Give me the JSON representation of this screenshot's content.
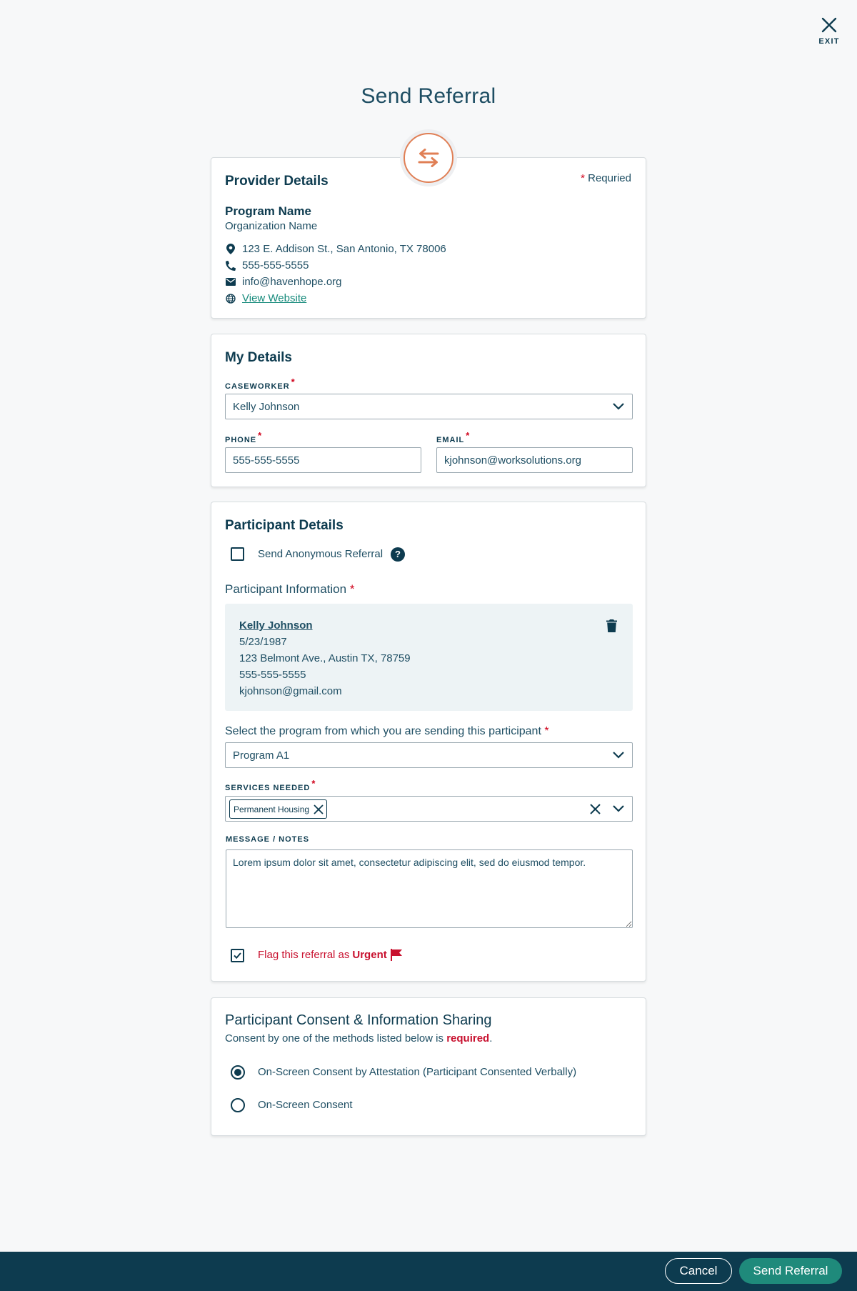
{
  "exit": {
    "label": "EXIT",
    "icon": "close-icon"
  },
  "page_title": "Send Referral",
  "hero_icon": "swap-arrows-icon",
  "colors": {
    "primary": "#0d3b4f",
    "accent": "#1f8a7b",
    "orange": "#e07f55",
    "required": "#d0021b",
    "urgent": "#c8102e"
  },
  "provider": {
    "title": "Provider Details",
    "required_note": "Requried",
    "program_name": "Program Name",
    "org_name": "Organization Name",
    "address": "123 E. Addison St., San Antonio, TX 78006",
    "phone": "555-555-5555",
    "email": "info@havenhope.org",
    "website_link": "View Website"
  },
  "my_details": {
    "title": "My Details",
    "caseworker_label": "CASEWORKER",
    "caseworker_value": "Kelly Johnson",
    "phone_label": "PHONE",
    "phone_value": "555-555-5555",
    "email_label": "EMAIL",
    "email_value": "kjohnson@worksolutions.org"
  },
  "participant": {
    "title": "Participant Details",
    "anonymous_label": "Send Anonymous Referral",
    "anonymous_checked": false,
    "help": "?",
    "info_label": "Participant Information",
    "name": "Kelly Johnson",
    "dob": "5/23/1987",
    "address": "123 Belmont Ave., Austin TX, 78759",
    "phone": "555-555-5555",
    "email": "kjohnson@gmail.com",
    "program_label": "Select the program from which you are sending this participant",
    "program_value": "Program A1",
    "services_label": "SERVICES NEEDED",
    "services": [
      "Permanent Housing"
    ],
    "notes_label": "MESSAGE / NOTES",
    "notes_value": "Lorem ipsum dolor sit amet, consectetur adipiscing elit, sed do eiusmod tempor.",
    "urgent_prefix": "Flag this referral as",
    "urgent_word": "Urgent",
    "urgent_checked": true
  },
  "consent": {
    "title": "Participant Consent & Information Sharing",
    "sub_prefix": "Consent by one of the methods listed below is",
    "sub_required": "required",
    "sub_suffix": ".",
    "options": [
      {
        "label": "On-Screen Consent by Attestation (Participant Consented Verbally)",
        "selected": true
      },
      {
        "label": "On-Screen Consent",
        "selected": false
      }
    ]
  },
  "footer": {
    "cancel_label": "Cancel",
    "send_label": "Send Referral"
  }
}
